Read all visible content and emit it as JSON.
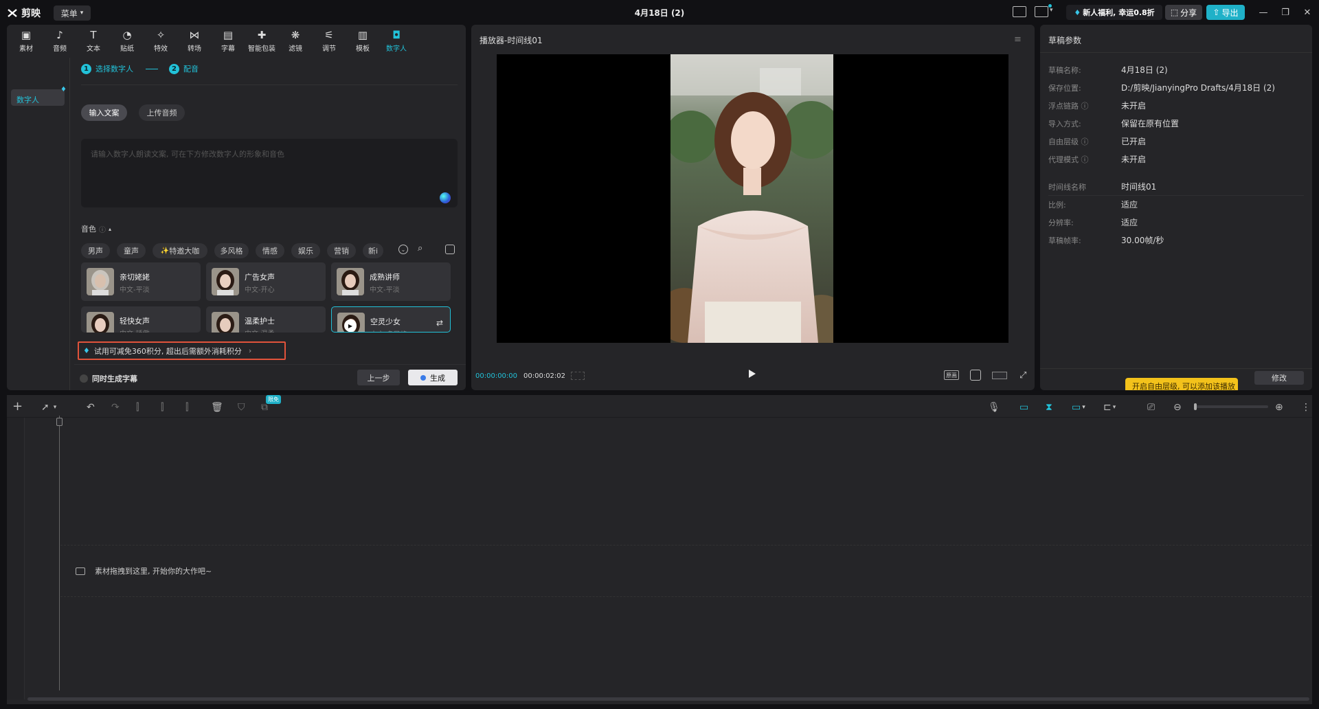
{
  "app": {
    "name": "剪映",
    "menu_label": "菜单",
    "project_title": "4月18日 (2)"
  },
  "topbar": {
    "promo": "新人福利, 幸运0.8折",
    "share": "分享",
    "export": "导出"
  },
  "toolbar": [
    {
      "label": "素材",
      "icon": "media-icon"
    },
    {
      "label": "音频",
      "icon": "audio-icon"
    },
    {
      "label": "文本",
      "icon": "text-icon"
    },
    {
      "label": "贴纸",
      "icon": "sticker-icon"
    },
    {
      "label": "特效",
      "icon": "effects-icon"
    },
    {
      "label": "转场",
      "icon": "transition-icon"
    },
    {
      "label": "字幕",
      "icon": "subtitle-icon"
    },
    {
      "label": "智能包装",
      "icon": "smart-pack-icon"
    },
    {
      "label": "滤镜",
      "icon": "filter-icon"
    },
    {
      "label": "调节",
      "icon": "adjust-icon"
    },
    {
      "label": "模板",
      "icon": "template-icon"
    },
    {
      "label": "数字人",
      "icon": "digital-human-icon",
      "active": true
    }
  ],
  "left_panel": {
    "sidebar_item": "数字人",
    "step1": "选择数字人",
    "step1_num": "1",
    "step2": "配音",
    "step2_num": "2",
    "tab_text": "输入文案",
    "tab_upload": "上传音频",
    "placeholder": "请输入数字人朗读文案, 可在下方修改数字人的形象和音色",
    "voice_title": "音色",
    "filters": [
      "男声",
      "童声",
      "特邀大咖",
      "多风格",
      "情感",
      "娱乐",
      "营销",
      "新i"
    ],
    "voices": [
      {
        "name": "亲切姥姥",
        "desc": "中文-平淡"
      },
      {
        "name": "广告女声",
        "desc": "中文-开心"
      },
      {
        "name": "成熟讲师",
        "desc": "中文-平淡"
      },
      {
        "name": "轻快女声",
        "desc": "中文-骄傲"
      },
      {
        "name": "温柔护士",
        "desc": "中文-温柔"
      },
      {
        "name": "空灵少女",
        "desc": "中文-多风格"
      }
    ],
    "notice": "试用可减免360积分, 超出后需额外消耗积分",
    "checkbox_label": "同时生成字幕",
    "prev_btn": "上一步",
    "generate_btn": "生成"
  },
  "player": {
    "title": "播放器-时间线01",
    "current_time": "00:00:00:00",
    "total_time": "00:00:02:02",
    "ratio_label": "原画"
  },
  "draft": {
    "title": "草稿参数",
    "rows": [
      {
        "label": "草稿名称:",
        "value": "4月18日 (2)"
      },
      {
        "label": "保存位置:",
        "value": "D:/剪映/JianyingPro Drafts/4月18日 (2)"
      },
      {
        "label": "浮点链路 ⓘ",
        "value": "未开启"
      },
      {
        "label": "导入方式:",
        "value": "保留在原有位置"
      },
      {
        "label": "自由层级 ⓘ",
        "value": "已开启"
      },
      {
        "label": "代理模式 ⓘ",
        "value": "未开启"
      }
    ],
    "rows2": [
      {
        "label": "时间线名称",
        "value": "时间线01"
      },
      {
        "label": "比例:",
        "value": "适应"
      },
      {
        "label": "分辨率:",
        "value": "适应"
      },
      {
        "label": "草稿帧率:",
        "value": "30.00帧/秒"
      }
    ],
    "yellow_btn": "开启自由层级, 可以添加该播放",
    "edit_btn": "修改"
  },
  "timeline": {
    "badge": "限免",
    "drop_hint": "素材拖拽到这里, 开始你的大作吧~"
  },
  "colors": {
    "accent": "#22c2d9",
    "bg": "#111114",
    "panel": "#252528",
    "notice_border": "#e2533b",
    "yellow": "#f3c21b"
  }
}
